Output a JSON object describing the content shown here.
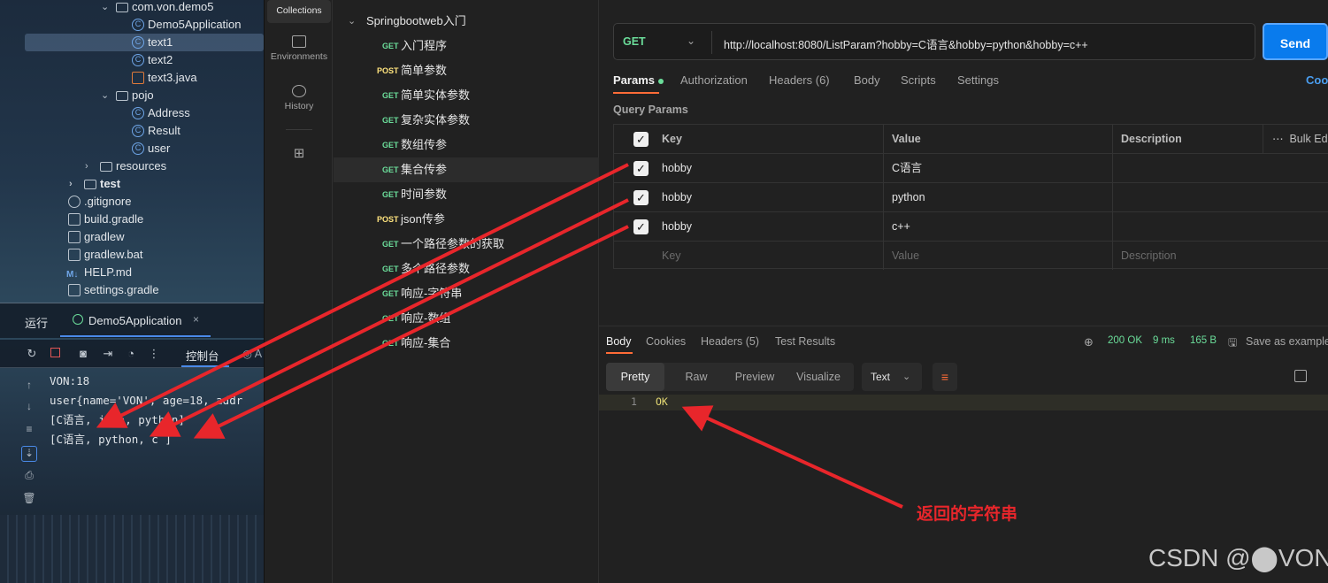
{
  "ide": {
    "tree": [
      {
        "label": "com.von.demo5",
        "type": "folder",
        "expanded": true
      },
      {
        "label": "Demo5Application",
        "type": "class"
      },
      {
        "label": "text1",
        "type": "class",
        "selected": true
      },
      {
        "label": "text2",
        "type": "class"
      },
      {
        "label": "text3.java",
        "type": "java"
      },
      {
        "label": "pojo",
        "type": "folder",
        "expanded": true
      },
      {
        "label": "Address",
        "type": "class"
      },
      {
        "label": "Result",
        "type": "class"
      },
      {
        "label": "user",
        "type": "class"
      },
      {
        "label": "resources",
        "type": "folder",
        "expanded": false
      },
      {
        "label": "test",
        "type": "folder",
        "expanded": false
      },
      {
        "label": ".gitignore",
        "type": "file"
      },
      {
        "label": "build.gradle",
        "type": "file"
      },
      {
        "label": "gradlew",
        "type": "file"
      },
      {
        "label": "gradlew.bat",
        "type": "file"
      },
      {
        "label": "HELP.md",
        "type": "md"
      },
      {
        "label": "settings.gradle",
        "type": "file"
      }
    ],
    "run_tab": "运行",
    "app_tab": "Demo5Application",
    "console_tab": "控制台",
    "console_tab_partial": "A",
    "console": [
      "VON:18",
      "user{name='VON', age=18, addr",
      "[C语言, java, python]",
      "[C语言, python, c  ]"
    ]
  },
  "nav": {
    "collections": "Collections",
    "environments": "Environments",
    "history": "History"
  },
  "collection": {
    "name": "Springbootweb入门",
    "items": [
      {
        "method": "GET",
        "name": "入门程序"
      },
      {
        "method": "POST",
        "name": "简单参数"
      },
      {
        "method": "GET",
        "name": "简单实体参数"
      },
      {
        "method": "GET",
        "name": "复杂实体参数"
      },
      {
        "method": "GET",
        "name": "数组传参"
      },
      {
        "method": "GET",
        "name": "集合传参",
        "active": true
      },
      {
        "method": "GET",
        "name": "时间参数"
      },
      {
        "method": "POST",
        "name": "json传参"
      },
      {
        "method": "GET",
        "name": "一个路径参数的获取"
      },
      {
        "method": "GET",
        "name": "多个路径参数"
      },
      {
        "method": "GET",
        "name": "响应-字符串"
      },
      {
        "method": "GET",
        "name": "响应-数组"
      },
      {
        "method": "GET",
        "name": "响应-集合"
      }
    ]
  },
  "request": {
    "method": "GET",
    "url": "http://localhost:8080/ListParam?hobby=C语言&hobby=python&hobby=c++",
    "send": "Send",
    "tabs": [
      "Params",
      "Authorization",
      "Headers (6)",
      "Body",
      "Scripts",
      "Settings"
    ],
    "cookies_link": "Cool",
    "query_title": "Query Params",
    "columns": [
      "Key",
      "Value",
      "Description"
    ],
    "bulk_edit": "Bulk Ed",
    "params": [
      {
        "key": "hobby",
        "value": "C语言",
        "checked": true
      },
      {
        "key": "hobby",
        "value": "python",
        "checked": true
      },
      {
        "key": "hobby",
        "value": "c++",
        "checked": true
      }
    ],
    "placeholders": {
      "key": "Key",
      "value": "Value",
      "description": "Description"
    }
  },
  "response": {
    "tabs": [
      "Body",
      "Cookies",
      "Headers (5)",
      "Test Results"
    ],
    "status": "200 OK",
    "time": "9 ms",
    "size": "165 B",
    "save": "Save as example",
    "views": [
      "Pretty",
      "Raw",
      "Preview",
      "Visualize"
    ],
    "format": "Text",
    "line_number": "1",
    "body": "OK"
  },
  "annotation": "返回的字符串",
  "watermark": "CSDN @⬤VON",
  "colors": {
    "get": "#6bdd9a",
    "post": "#ffe47e",
    "send": "#097bed",
    "arrow": "#e8262b",
    "accent": "#ff6c37"
  }
}
